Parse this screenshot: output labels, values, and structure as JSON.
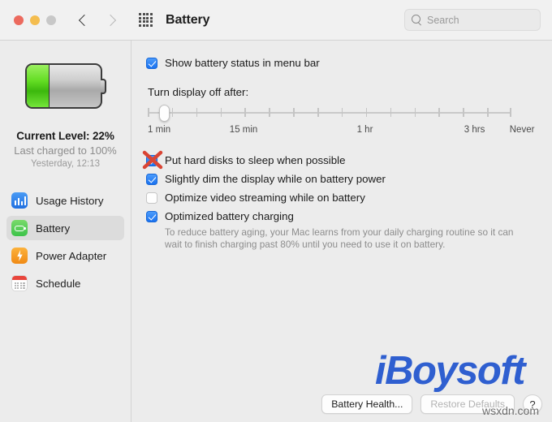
{
  "window": {
    "title": "Battery",
    "traffic_lights": [
      "close",
      "minimize",
      "zoom"
    ],
    "back_label": "Back",
    "forward_label": "Forward",
    "grid_label": "Show All"
  },
  "search": {
    "placeholder": "Search",
    "value": ""
  },
  "sidebar": {
    "battery_graphic": {
      "fill_percent": 22,
      "fill_color": "#3cb80d"
    },
    "status": {
      "current_level": "Current Level: 22%",
      "last_charged": "Last charged to 100%",
      "last_charged_when": "Yesterday, 12:13"
    },
    "items": [
      {
        "label": "Usage History",
        "icon": "usage-history-icon",
        "selected": false
      },
      {
        "label": "Battery",
        "icon": "battery-icon",
        "selected": true
      },
      {
        "label": "Power Adapter",
        "icon": "power-adapter-icon",
        "selected": false
      },
      {
        "label": "Schedule",
        "icon": "schedule-icon",
        "selected": false
      }
    ]
  },
  "main": {
    "show_status_label": "Show battery status in menu bar",
    "show_status_checked": true,
    "display_off": {
      "title": "Turn display off after:",
      "tick_count": 16,
      "value_index": 1,
      "labels": [
        {
          "text": "1 min",
          "pos_percent": 0
        },
        {
          "text": "15 min",
          "pos_percent": 23
        },
        {
          "text": "1 hr",
          "pos_percent": 58
        },
        {
          "text": "3 hrs",
          "pos_percent": 88
        },
        {
          "text": "Never",
          "pos_percent": 100
        }
      ]
    },
    "options": [
      {
        "label": "Put hard disks to sleep when possible",
        "checked": true,
        "annotated_red_x": true
      },
      {
        "label": "Slightly dim the display while on battery power",
        "checked": true,
        "annotated_red_x": false
      },
      {
        "label": "Optimize video streaming while on battery",
        "checked": false,
        "annotated_red_x": false
      },
      {
        "label": "Optimized battery charging",
        "checked": true,
        "annotated_red_x": false
      }
    ],
    "optimized_description": "To reduce battery aging, your Mac learns from your daily charging routine so it can wait to finish charging past 80% until you need to use it on battery.",
    "buttons": {
      "battery_health": "Battery Health...",
      "restore_defaults": "Restore Defaults",
      "help": "?"
    }
  },
  "overlay": {
    "watermark": "iBoysoft",
    "site": "wsxdn.com",
    "watermark_color": "#2f5fd0"
  }
}
